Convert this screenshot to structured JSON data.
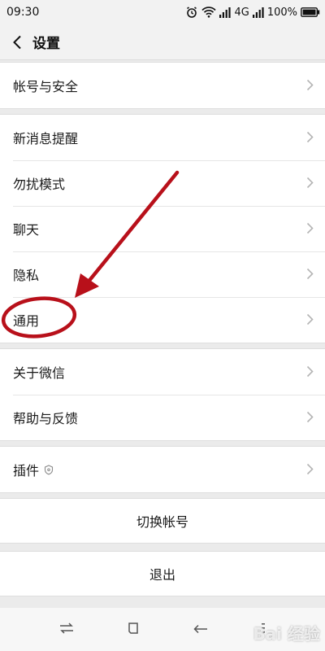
{
  "status_bar": {
    "time": "09:30",
    "network": "4G",
    "battery": "100%"
  },
  "nav": {
    "title": "设置"
  },
  "groups": [
    [
      "帐号与安全"
    ],
    [
      "新消息提醒",
      "勿扰模式",
      "聊天",
      "隐私",
      "通用"
    ],
    [
      "关于微信",
      "帮助与反馈"
    ],
    [
      "插件"
    ]
  ],
  "actions": {
    "switch_account": "切换帐号",
    "logout": "退出"
  },
  "watermark": "Bai 经验",
  "colors": {
    "annotation": "#b8101a",
    "background": "#ebebeb"
  }
}
